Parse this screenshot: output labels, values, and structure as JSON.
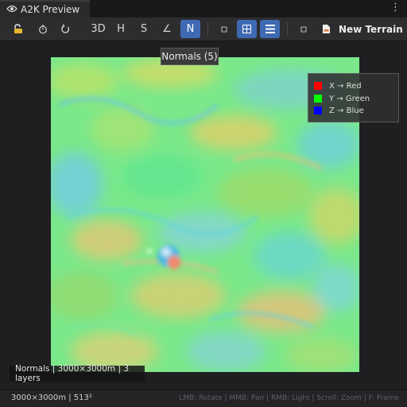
{
  "window": {
    "tab_title": "A2K Preview",
    "tab_icon": "eye-icon",
    "menu_glyph": "⋮"
  },
  "toolbar": {
    "lock_icon": "lock-icon",
    "timer_icon": "timer-icon",
    "refresh_icon": "refresh-icon",
    "modes": [
      {
        "label": "3D",
        "active": false
      },
      {
        "label": "H",
        "active": false
      },
      {
        "label": "S",
        "active": false
      },
      {
        "label": "∠",
        "active": false
      },
      {
        "label": "N",
        "active": true
      }
    ],
    "view_buttons": [
      {
        "name": "square-small-icon",
        "active": false
      },
      {
        "name": "grid-icon",
        "active": true
      },
      {
        "name": "list-icon",
        "active": true
      }
    ],
    "asset_icon": "document-icon",
    "terrain_name": "New Terrain",
    "accent_color": "#3f6ab3"
  },
  "tooltip": {
    "text": "Normals (5)"
  },
  "legend": {
    "items": [
      {
        "color": "#ff0000",
        "label": "X → Red"
      },
      {
        "color": "#00ff00",
        "label": "Y → Green"
      },
      {
        "color": "#0000ff",
        "label": "Z → Blue"
      }
    ]
  },
  "viewport": {
    "overlay_label": "Normals | 3000×3000m | 3 layers"
  },
  "status": {
    "left": "3000×3000m | 513²",
    "right": "LMB: Rotate | MMB: Pan | RMB: Light | Scroll: Zoom | F: Frame"
  }
}
